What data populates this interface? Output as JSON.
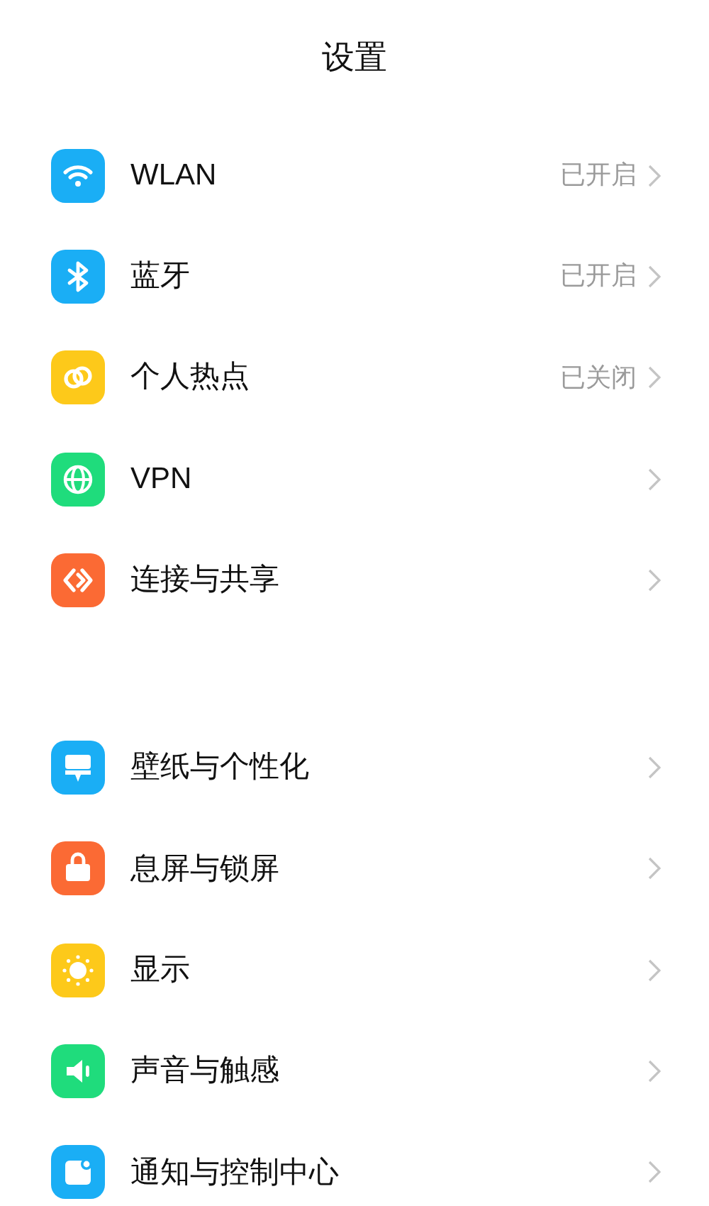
{
  "title": "设置",
  "sections": [
    {
      "items": [
        {
          "kind": "wifi",
          "color": "#1aaef5",
          "label": "WLAN",
          "value": "已开启"
        },
        {
          "kind": "bluetooth",
          "color": "#1aaef5",
          "label": "蓝牙",
          "value": "已开启"
        },
        {
          "kind": "hotspot",
          "color": "#fdc91a",
          "label": "个人热点",
          "value": "已关闭"
        },
        {
          "kind": "globe",
          "color": "#1fdc7c",
          "label": "VPN"
        },
        {
          "kind": "share",
          "color": "#fb6a34",
          "label": "连接与共享"
        }
      ]
    },
    {
      "items": [
        {
          "kind": "brush",
          "color": "#1aaef5",
          "label": "壁纸与个性化"
        },
        {
          "kind": "lock",
          "color": "#fb6a34",
          "label": "息屏与锁屏"
        },
        {
          "kind": "sun",
          "color": "#fdc91a",
          "label": "显示"
        },
        {
          "kind": "speaker",
          "color": "#1fdc7c",
          "label": "声音与触感"
        },
        {
          "kind": "notify",
          "color": "#1aaef5",
          "label": "通知与控制中心"
        }
      ]
    }
  ]
}
